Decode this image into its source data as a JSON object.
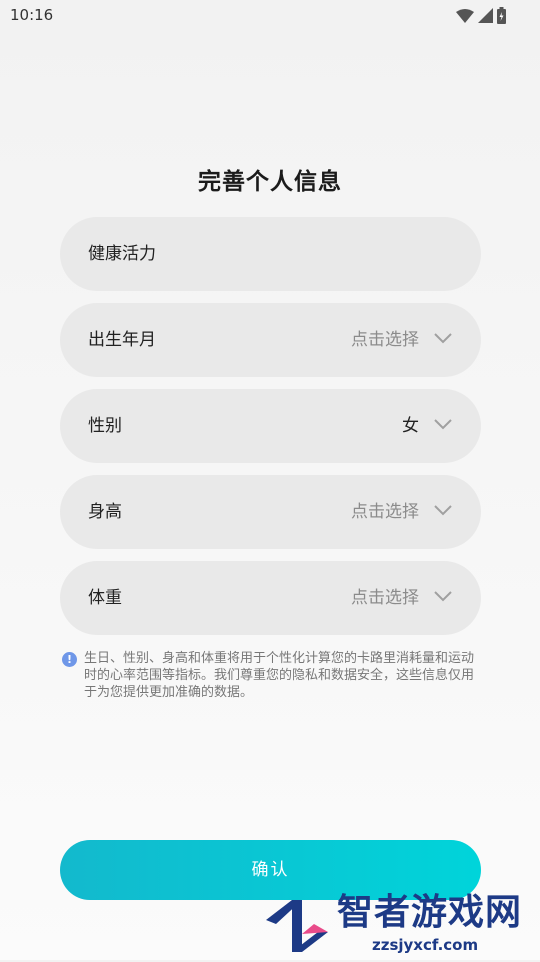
{
  "status_bar": {
    "time": "10:16",
    "icons": [
      "wifi-icon",
      "signal-icon",
      "battery-icon"
    ]
  },
  "page": {
    "title": "完善个人信息"
  },
  "form": {
    "rows": [
      {
        "label": "健康活力",
        "value": ""
      },
      {
        "label": "出生年月",
        "value": "点击选择"
      },
      {
        "label": "性别",
        "value": "女"
      },
      {
        "label": "身高",
        "value": "点击选择"
      },
      {
        "label": "体重",
        "value": "点击选择"
      }
    ]
  },
  "notice": {
    "icon": "info-icon",
    "icon_glyph": "!",
    "text": "生日、性别、身高和体重将用于个性化计算您的卡路里消耗量和运动时的心率范围等指标。我们尊重您的隐私和数据安全，这些信息仅用于为您提供更加准确的数据。"
  },
  "actions": {
    "confirm_label": "确认"
  },
  "watermark": {
    "title": "智者游戏网",
    "url": "zzsjyxcf.com"
  },
  "colors": {
    "accent_start": "#13b9cd",
    "accent_end": "#00d4da",
    "row_background": "#e9e9e9",
    "placeholder_text": "#8b8b8b",
    "info_icon": "#6f97e8"
  }
}
